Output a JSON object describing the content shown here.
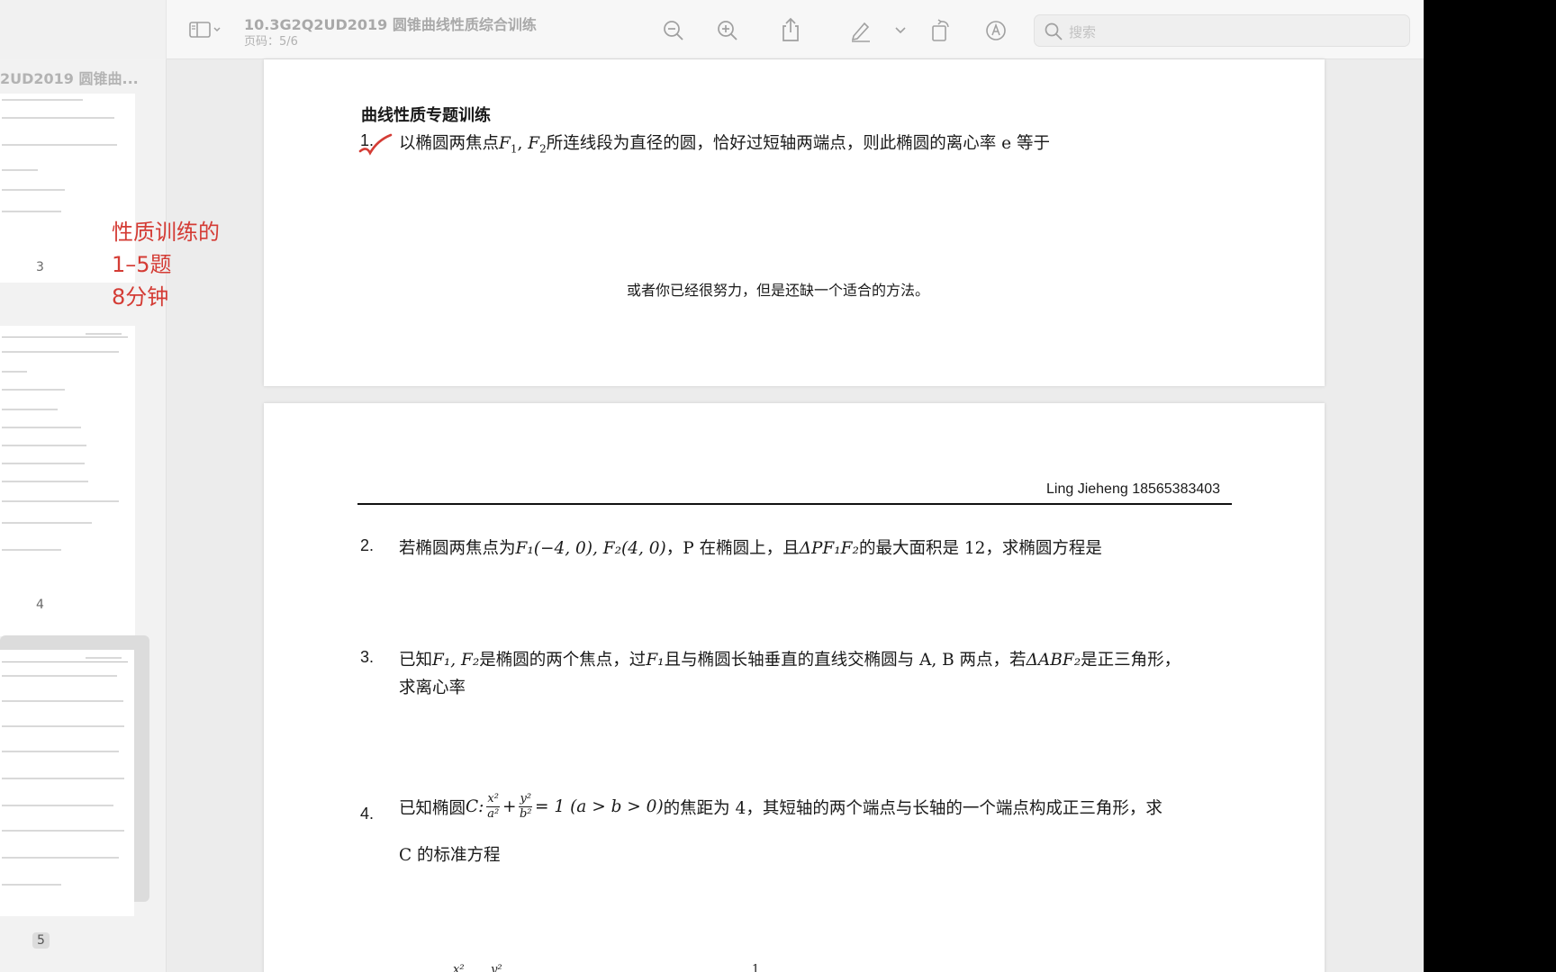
{
  "toolbar": {
    "title": "10.3G2Q2UD2019 圆锥曲线性质综合训练",
    "page_label": "页码：5/6",
    "search_placeholder": "搜索",
    "icons": [
      "sidebar-toggle-icon",
      "chevron-down-icon",
      "zoom-out-icon",
      "zoom-in-icon",
      "share-icon",
      "markup-pen-icon",
      "rotate-icon",
      "annotate-icon",
      "search-icon"
    ]
  },
  "sidebar": {
    "title": "2UD2019 圆锥曲...",
    "pages": [
      {
        "label": "3"
      },
      {
        "label": "4"
      },
      {
        "label": "5"
      }
    ]
  },
  "annotation": {
    "lines": [
      "性质训练的",
      "1–5题",
      "8分钟"
    ],
    "color": "#d43c35"
  },
  "doc": {
    "page1": {
      "heading": "曲线性质专题训练",
      "q1_num": "1.",
      "q1_a": "以椭圆两焦点",
      "q1_m1": "F",
      "q1_s1": "1",
      "q1_c": ",",
      "q1_m2": "F",
      "q1_s2": "2",
      "q1_b": "所连线段为直径的圆，恰好过短轴两端点，则此椭圆的离心率 e 等于",
      "motto": "或者你已经很努力，但是还缺一个适合的方法。"
    },
    "page2": {
      "header": "Ling Jieheng 18565383403",
      "q2_num": "2.",
      "q2_a": "若椭圆两焦点为",
      "q2_m": "F₁(−4, 0), F₂(4, 0)",
      "q2_b": "，P 在椭圆上，且",
      "q2_m2": "ΔPF₁F₂",
      "q2_c": "的最大面积是 12，求椭圆方程是",
      "q3_num": "3.",
      "q3_a": "已知",
      "q3_m1": "F₁, F₂",
      "q3_b": "是椭圆的两个焦点，过",
      "q3_m2": "F₁",
      "q3_c": "且与椭圆长轴垂直的直线交椭圆与 A, B 两点，若",
      "q3_m3": "ΔABF₂",
      "q3_d": "是正三角形，",
      "q3_line2": "求离心率",
      "q4_num": "4.",
      "q4_a": "已知椭圆",
      "q4_m1": "C:",
      "q4_m2": "= 1 (a > b > 0)",
      "q4_b": "的焦距为 4，其短轴的两个端点与长轴的一个端点构成正三角形，求",
      "q4_line2": "C 的标准方程",
      "frac1_num": "x²",
      "frac1_den": "a²",
      "frac2_num": "y²",
      "frac2_den": "b²",
      "plus": "+",
      "q5_partial_1": "x²",
      "q5_partial_2": "y²",
      "q5_partial_3": "1"
    }
  }
}
